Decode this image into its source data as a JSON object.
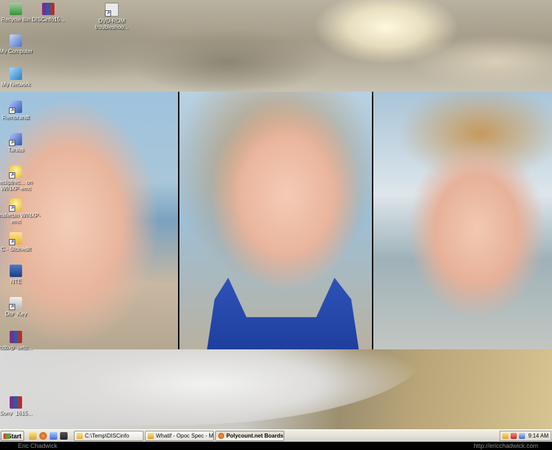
{
  "desktop": {
    "icons": [
      {
        "label": "Recycle Bin",
        "icon": "recycle-bin-icon"
      },
      {
        "label": "DISCinfo15...",
        "icon": "winrar-archive-icon"
      },
      {
        "label": "DVD-ROM troubleshoo...",
        "icon": "dvd-rom-shortcut-icon"
      },
      {
        "label": "My Computer",
        "icon": "my-computer-icon"
      },
      {
        "label": "My Network",
        "icon": "my-network-icon"
      },
      {
        "label": "Rembrandt",
        "icon": "app-shortcut-icon"
      },
      {
        "label": "Tarsus",
        "icon": "app-shortcut-icon"
      },
      {
        "label": "ecliptrec... on WINXP-emc",
        "icon": "lightbulb-shortcut-icon"
      },
      {
        "label": "Transferbin WINXP-emc",
        "icon": "lightbulb-shortcut-icon"
      },
      {
        "label": "C - Stcinedit",
        "icon": "folder-shortcut-icon"
      },
      {
        "label": "NTE",
        "icon": "nte-app-icon"
      },
      {
        "label": "Dor_Key",
        "icon": "key-shortcut-icon"
      },
      {
        "label": "cdbxp_setu...",
        "icon": "winrar-archive-icon"
      },
      {
        "label": "Sony_1615...",
        "icon": "winrar-archive-icon"
      }
    ]
  },
  "taskbar": {
    "start_label": "Start",
    "quick_launch": [
      "ie-icon",
      "firefox-icon",
      "explorer-icon",
      "show-desktop-icon"
    ],
    "tasks": [
      {
        "label": "C:\\Temp\\DISCinfo",
        "icon": "folder-icon"
      },
      {
        "label": "Whatif - Opoc Spec - Mic...",
        "icon": "ie-icon"
      },
      {
        "label": "Polycount.net Boards: D...",
        "icon": "firefox-icon"
      }
    ],
    "tray": {
      "icons": [
        "tray-app-icon",
        "tray-shield-icon",
        "tray-network-icon"
      ],
      "clock": "9:14 AM"
    }
  },
  "credits": {
    "left": "Eric Chadwick",
    "right": "http://ericchadwick.com"
  },
  "colors": {
    "taskbar": "#d4d0c8",
    "swimsuit": "#2e52b8"
  }
}
